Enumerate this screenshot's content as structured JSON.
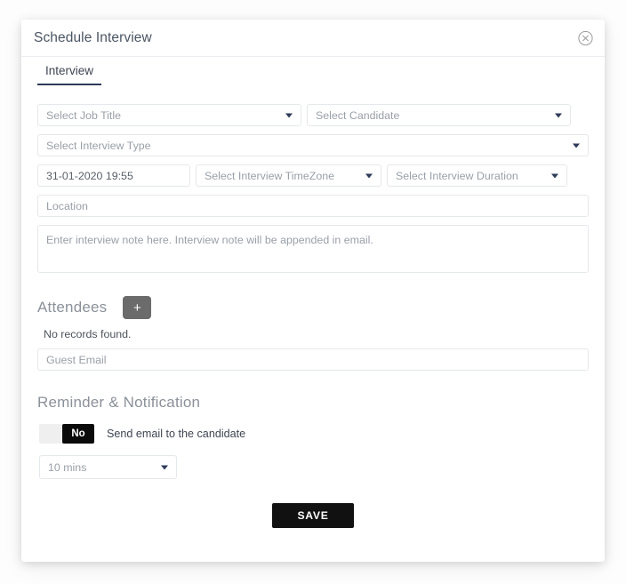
{
  "modal": {
    "title": "Schedule Interview",
    "close_icon": "close-circle-icon"
  },
  "tabs": [
    {
      "label": "Interview",
      "active": true
    }
  ],
  "form": {
    "job_title": {
      "placeholder": "Select Job Title",
      "value": ""
    },
    "candidate": {
      "placeholder": "Select Candidate",
      "value": ""
    },
    "interview_type": {
      "placeholder": "Select Interview Type",
      "value": ""
    },
    "datetime": {
      "placeholder": "",
      "value": "31-01-2020 19:55"
    },
    "timezone": {
      "placeholder": "Select Interview TimeZone",
      "value": ""
    },
    "duration": {
      "placeholder": "Select Interview Duration",
      "value": ""
    },
    "location": {
      "placeholder": "Location",
      "value": ""
    },
    "note": {
      "placeholder": "Enter interview note here. Interview note will be appended in email.",
      "value": ""
    }
  },
  "attendees": {
    "title": "Attendees",
    "add_label": "+",
    "empty_text": "No records found.",
    "guest_email": {
      "placeholder": "Guest Email",
      "value": ""
    }
  },
  "reminder": {
    "title": "Reminder & Notification",
    "toggle_state": "No",
    "toggle_label": "Send email to the candidate",
    "interval": "10 mins"
  },
  "actions": {
    "save_label": "SAVE"
  },
  "colors": {
    "accent": "#2e3a59",
    "dark": "#111111",
    "muted": "#9aa0a8",
    "border": "#e5e8ec",
    "add_button": "#6b6b6b"
  }
}
